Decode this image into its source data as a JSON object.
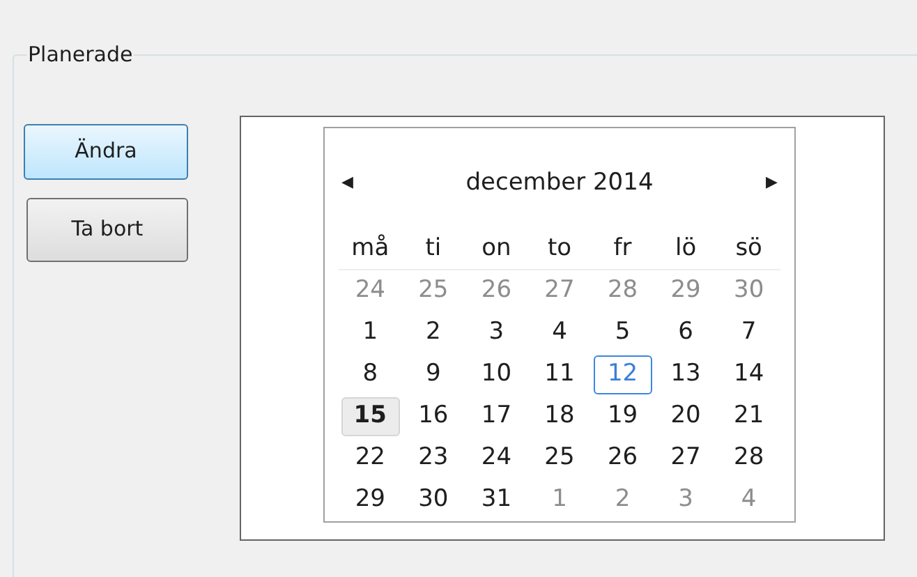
{
  "group": {
    "title": "Planerade"
  },
  "buttons": [
    {
      "label": "Ändra",
      "focused": true
    },
    {
      "label": "Ta bort",
      "focused": false
    }
  ],
  "calendar": {
    "month": "december 2014",
    "prev": "◀",
    "next": "▶",
    "weekdays": [
      "må",
      "ti",
      "on",
      "to",
      "fr",
      "lö",
      "sö"
    ],
    "weeks": [
      [
        {
          "d": "24",
          "muted": true,
          "today": false,
          "selected": false
        },
        {
          "d": "25",
          "muted": true,
          "today": false,
          "selected": false
        },
        {
          "d": "26",
          "muted": true,
          "today": false,
          "selected": false
        },
        {
          "d": "27",
          "muted": true,
          "today": false,
          "selected": false
        },
        {
          "d": "28",
          "muted": true,
          "today": false,
          "selected": false
        },
        {
          "d": "29",
          "muted": true,
          "today": false,
          "selected": false
        },
        {
          "d": "30",
          "muted": true,
          "today": false,
          "selected": false
        }
      ],
      [
        {
          "d": "1",
          "muted": false,
          "today": false,
          "selected": false
        },
        {
          "d": "2",
          "muted": false,
          "today": false,
          "selected": false
        },
        {
          "d": "3",
          "muted": false,
          "today": false,
          "selected": false
        },
        {
          "d": "4",
          "muted": false,
          "today": false,
          "selected": false
        },
        {
          "d": "5",
          "muted": false,
          "today": false,
          "selected": false
        },
        {
          "d": "6",
          "muted": false,
          "today": false,
          "selected": false
        },
        {
          "d": "7",
          "muted": false,
          "today": false,
          "selected": false
        }
      ],
      [
        {
          "d": "8",
          "muted": false,
          "today": false,
          "selected": false
        },
        {
          "d": "9",
          "muted": false,
          "today": false,
          "selected": false
        },
        {
          "d": "10",
          "muted": false,
          "today": false,
          "selected": false
        },
        {
          "d": "11",
          "muted": false,
          "today": false,
          "selected": false
        },
        {
          "d": "12",
          "muted": false,
          "today": true,
          "selected": false
        },
        {
          "d": "13",
          "muted": false,
          "today": false,
          "selected": false
        },
        {
          "d": "14",
          "muted": false,
          "today": false,
          "selected": false
        }
      ],
      [
        {
          "d": "15",
          "muted": false,
          "today": false,
          "selected": true
        },
        {
          "d": "16",
          "muted": false,
          "today": false,
          "selected": false
        },
        {
          "d": "17",
          "muted": false,
          "today": false,
          "selected": false
        },
        {
          "d": "18",
          "muted": false,
          "today": false,
          "selected": false
        },
        {
          "d": "19",
          "muted": false,
          "today": false,
          "selected": false
        },
        {
          "d": "20",
          "muted": false,
          "today": false,
          "selected": false
        },
        {
          "d": "21",
          "muted": false,
          "today": false,
          "selected": false
        }
      ],
      [
        {
          "d": "22",
          "muted": false,
          "today": false,
          "selected": false
        },
        {
          "d": "23",
          "muted": false,
          "today": false,
          "selected": false
        },
        {
          "d": "24",
          "muted": false,
          "today": false,
          "selected": false
        },
        {
          "d": "25",
          "muted": false,
          "today": false,
          "selected": false
        },
        {
          "d": "26",
          "muted": false,
          "today": false,
          "selected": false
        },
        {
          "d": "27",
          "muted": false,
          "today": false,
          "selected": false
        },
        {
          "d": "28",
          "muted": false,
          "today": false,
          "selected": false
        }
      ],
      [
        {
          "d": "29",
          "muted": false,
          "today": false,
          "selected": false
        },
        {
          "d": "30",
          "muted": false,
          "today": false,
          "selected": false
        },
        {
          "d": "31",
          "muted": false,
          "today": false,
          "selected": false
        },
        {
          "d": "1",
          "muted": true,
          "today": false,
          "selected": false
        },
        {
          "d": "2",
          "muted": true,
          "today": false,
          "selected": false
        },
        {
          "d": "3",
          "muted": true,
          "today": false,
          "selected": false
        },
        {
          "d": "4",
          "muted": true,
          "today": false,
          "selected": false
        }
      ]
    ]
  }
}
